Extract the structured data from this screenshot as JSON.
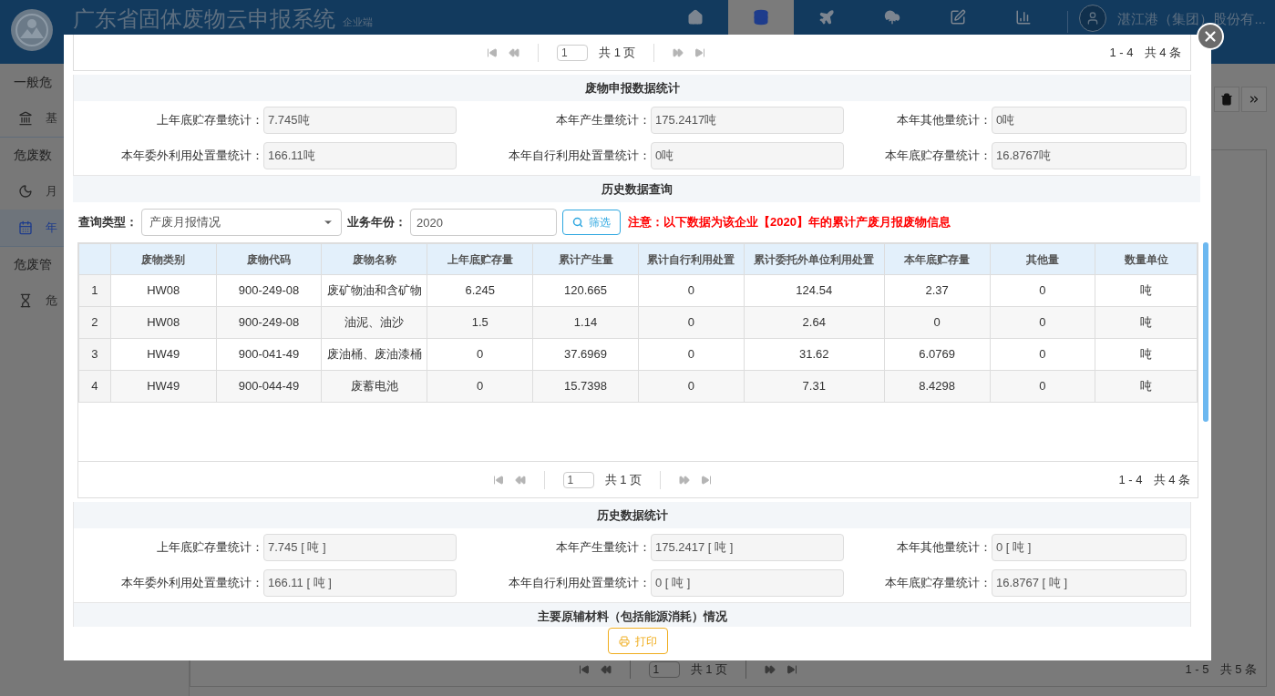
{
  "app": {
    "title": "广东省固体废物云申报系统",
    "subtitle": "企业端",
    "nav": [
      {
        "kind": "home",
        "selected": false
      },
      {
        "kind": "database",
        "selected": true
      },
      {
        "kind": "plane",
        "selected": false
      },
      {
        "kind": "upload",
        "selected": false
      },
      {
        "kind": "edit",
        "selected": false
      },
      {
        "kind": "chart",
        "selected": false
      }
    ],
    "user": "湛江港（集团）股份有...",
    "sidebar": [
      {
        "kind": "group",
        "label": "一般危"
      },
      {
        "kind": "bank",
        "label": "基",
        "selected": false
      },
      {
        "kind": "group",
        "label": "危废数"
      },
      {
        "kind": "moon",
        "label": "月",
        "selected": false
      },
      {
        "kind": "calendar",
        "label": "年",
        "selected": true
      },
      {
        "kind": "group",
        "label": "危废管"
      },
      {
        "kind": "hourglass",
        "label": "危",
        "selected": false
      }
    ],
    "pager": {
      "page": "1",
      "pages": "共 1 页",
      "range": "1 - 5",
      "total": "共 5 条"
    }
  },
  "modal": {
    "top_pager": {
      "page": "1",
      "pages": "共 1 页",
      "range": "1 - 4",
      "total": "共 4 条"
    },
    "declared_stats": {
      "title": "废物申报数据统计",
      "fields": [
        {
          "label": "上年底贮存量统计：",
          "value": "7.745吨"
        },
        {
          "label": "本年产生量统计：",
          "value": "175.2417吨"
        },
        {
          "label": "本年其他量统计：",
          "value": "0吨"
        },
        {
          "label": "本年委外利用处置量统计：",
          "value": "166.11吨"
        },
        {
          "label": "本年自行利用处置量统计：",
          "value": "0吨"
        },
        {
          "label": "本年底贮存量统计：",
          "value": "16.8767吨"
        }
      ]
    },
    "history_query": {
      "title": "历史数据查询",
      "type_label": "查询类型：",
      "type_value": "产废月报情况",
      "year_label": "业务年份：",
      "year_value": "2020",
      "filter_button": "筛选",
      "notice": "注意：以下数据为该企业【2020】年的累计产废月报废物信息",
      "table": {
        "columns": [
          "废物类别",
          "废物代码",
          "废物名称",
          "上年底贮存量",
          "累计产生量",
          "累计自行利用处置",
          "累计委托外单位利用处置",
          "本年底贮存量",
          "其他量",
          "数量单位"
        ],
        "rows": [
          {
            "index": "1",
            "cells": [
              "HW08",
              "900-249-08",
              "废矿物油和含矿物",
              "6.245",
              "120.665",
              "0",
              "124.54",
              "2.37",
              "0",
              "吨"
            ]
          },
          {
            "index": "2",
            "cells": [
              "HW08",
              "900-249-08",
              "油泥、油沙",
              "1.5",
              "1.14",
              "0",
              "2.64",
              "0",
              "0",
              "吨"
            ]
          },
          {
            "index": "3",
            "cells": [
              "HW49",
              "900-041-49",
              "废油桶、废油漆桶",
              "0",
              "37.6969",
              "0",
              "31.62",
              "6.0769",
              "0",
              "吨"
            ]
          },
          {
            "index": "4",
            "cells": [
              "HW49",
              "900-044-49",
              "废蓄电池",
              "0",
              "15.7398",
              "0",
              "7.31",
              "8.4298",
              "0",
              "吨"
            ]
          }
        ]
      },
      "pager": {
        "page": "1",
        "pages": "共 1 页",
        "range": "1 - 4",
        "total": "共 4 条"
      }
    },
    "history_stats": {
      "title": "历史数据统计",
      "fields": [
        {
          "label": "上年底贮存量统计：",
          "value": "7.745 [ 吨 ]"
        },
        {
          "label": "本年产生量统计：",
          "value": "175.2417 [ 吨 ]"
        },
        {
          "label": "本年其他量统计：",
          "value": "0 [ 吨 ]"
        },
        {
          "label": "本年委外利用处置量统计：",
          "value": "166.11 [ 吨 ]"
        },
        {
          "label": "本年自行利用处置量统计：",
          "value": "0 [ 吨 ]"
        },
        {
          "label": "本年底贮存量统计：",
          "value": "16.8767 [ 吨 ]"
        }
      ]
    },
    "materials": {
      "title": "主要原辅材料（包括能源消耗）情况"
    },
    "print_button": "打印"
  }
}
